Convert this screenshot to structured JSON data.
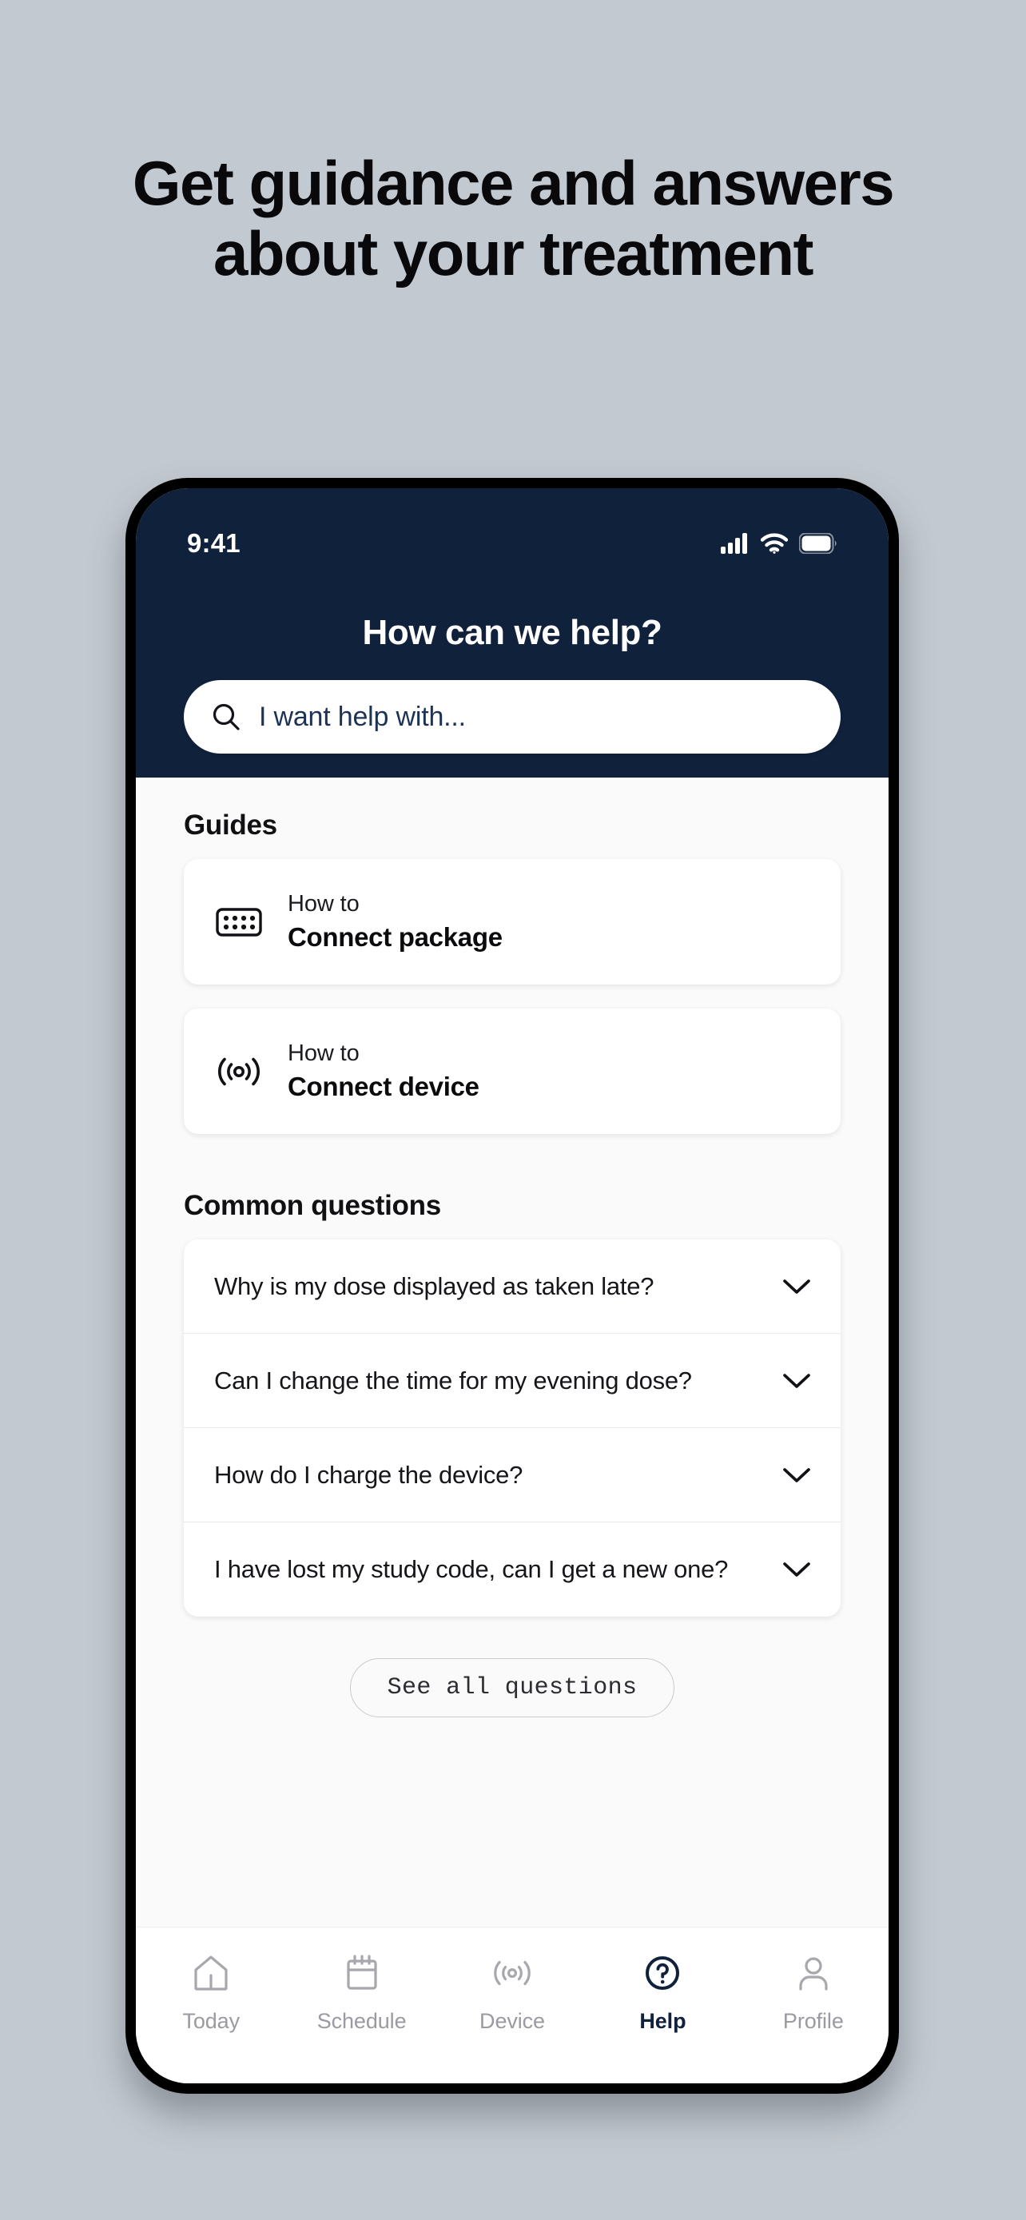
{
  "promo": {
    "line1": "Get guidance and answers",
    "line2": "about your treatment"
  },
  "colors": {
    "page_background": "#c3c9d0",
    "header_navy": "#10213c",
    "screen_background": "#fafafa",
    "card_white": "#ffffff",
    "tab_inactive": "#9a9aa0",
    "tab_active": "#10213c"
  },
  "status_bar": {
    "time": "9:41",
    "icons": [
      "cellular-signal-icon",
      "wifi-icon",
      "battery-icon"
    ]
  },
  "header": {
    "title": "How can we help?"
  },
  "search": {
    "placeholder": "I want help with...",
    "value": "",
    "icon": "search-icon"
  },
  "guides": {
    "section_title": "Guides",
    "items": [
      {
        "kicker": "How to",
        "title": "Connect package",
        "icon": "blister-pack-icon"
      },
      {
        "kicker": "How to",
        "title": "Connect device",
        "icon": "broadcast-signal-icon"
      }
    ]
  },
  "faq": {
    "section_title": "Common questions",
    "items": [
      {
        "question": "Why is my dose displayed as taken late?",
        "icon": "chevron-down-icon"
      },
      {
        "question": "Can I change the time for my evening dose?",
        "icon": "chevron-down-icon"
      },
      {
        "question": "How do I charge the device?",
        "icon": "chevron-down-icon"
      },
      {
        "question": "I have lost my study code, can I get a new one?",
        "icon": "chevron-down-icon"
      }
    ],
    "see_all_label": "See all questions"
  },
  "tab_bar": {
    "items": [
      {
        "label": "Today",
        "icon": "home-icon",
        "active": false
      },
      {
        "label": "Schedule",
        "icon": "calendar-icon",
        "active": false
      },
      {
        "label": "Device",
        "icon": "broadcast-icon",
        "active": false
      },
      {
        "label": "Help",
        "icon": "question-circle-icon",
        "active": true
      },
      {
        "label": "Profile",
        "icon": "person-icon",
        "active": false
      }
    ]
  }
}
